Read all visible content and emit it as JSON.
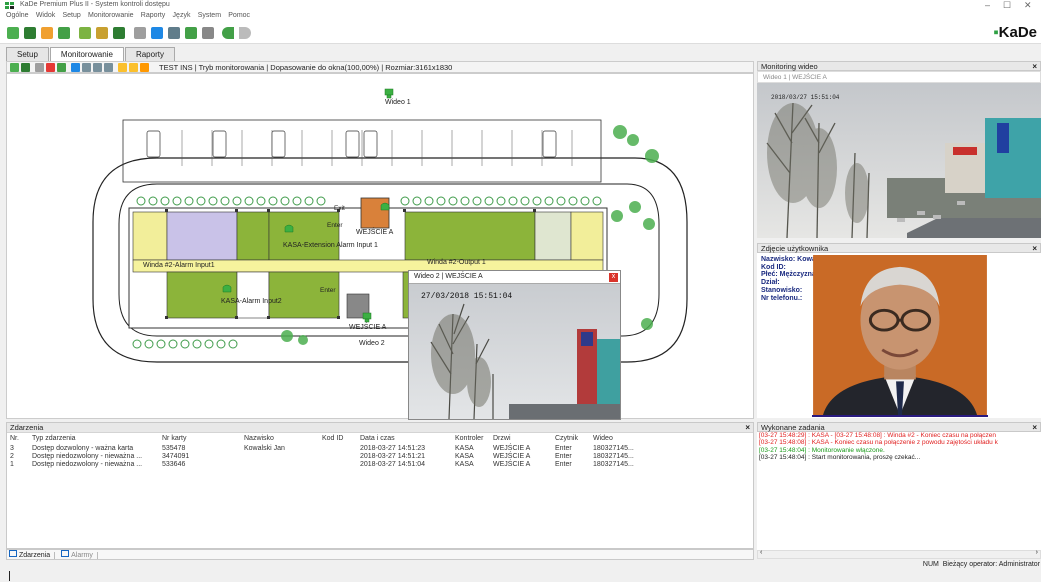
{
  "window": {
    "title": "KaDe Premium Plus II - System kontroli dostępu",
    "controls": [
      "–",
      "☐",
      "✕"
    ]
  },
  "menu": [
    "Ogólne",
    "Widok",
    "Setup",
    "Monitorowanie",
    "Raporty",
    "Język",
    "System",
    "Pomoc"
  ],
  "brand": "KaDe",
  "tabs": [
    "Setup",
    "Monitorowanie",
    "Raporty"
  ],
  "active_tab": "Monitorowanie",
  "map_status": "TEST INS | Tryb monitorowania | Dopasowanie do okna(100,00%) | Rozmiar:3161x1830",
  "map_labels": {
    "wideo1": "Wideo 1",
    "wideo2": "Wideo 2",
    "exit": "Exit",
    "enter1": "Enter",
    "enter2": "Enter",
    "wejscie_top": "WEJŚCIE A",
    "wejscie_bottom": "WEJŚCIE A",
    "kasa_ext": "KASA-Extension Alarm Input 1",
    "winda_alarm": "Winda #2-Alarm Input1",
    "winda_output": "Winda #2-Output 1",
    "kasa_alarm": "KASA-Alarm Input2"
  },
  "video_popup": {
    "title": "Wideo 2 | WEJŚCIE A",
    "timestamp": "27/03/2018 15:51:04",
    "close": "x"
  },
  "camera_panel": {
    "title": "Monitoring wideo",
    "subtitle": "Wideo 1 | WEJŚCIE A",
    "overlay_text": "2018/03/27 15:51:04"
  },
  "user_panel": {
    "title": "Zdjęcie użytkownika",
    "fields": [
      "Nazwisko: Kowalski Jan",
      "Kod ID:",
      "Płeć: Mężczyzna",
      "Dział:",
      "Stanowisko:",
      "Nr telefonu.:"
    ]
  },
  "events": {
    "title": "Zdarzenia",
    "columns": [
      "Nr.",
      "Typ zdarzenia",
      "Nr karty",
      "Nazwisko",
      "Kod ID",
      "Data i czas",
      "Kontroler",
      "Drzwi",
      "Czytnik",
      "Wideo"
    ],
    "rows": [
      [
        "3",
        "Dostęp dozwolony - ważna karta",
        "535478",
        "Kowalski Jan",
        "",
        "2018-03-27 14:51:23",
        "KASA",
        "WEJŚCIE A",
        "Enter",
        "180327145..."
      ],
      [
        "2",
        "Dostęp niedozwolony - nieważna ...",
        "3474091",
        "",
        "",
        "2018-03-27 14:51:21",
        "KASA",
        "WEJŚCIE A",
        "Enter",
        "180327145..."
      ],
      [
        "1",
        "Dostęp niedozwolony - nieważna ...",
        "533646",
        "",
        "",
        "2018-03-27 14:51:04",
        "KASA",
        "WEJŚCIE A",
        "Enter",
        "180327145..."
      ]
    ]
  },
  "bottom_tabs": [
    "Zdarzenia",
    "Alarmy"
  ],
  "tasks": {
    "title": "Wykonane zadania",
    "lines": [
      {
        "text": "[03-27 15:48:29] : KASA - [03-27 15:48:08] : Winda #2 - Koniec czasu na połączen",
        "color": "#e02020"
      },
      {
        "text": "[03-27 15:48:08] : KASA - Koniec czasu na połączenie z powodu zajętości układu k",
        "color": "#e02020"
      },
      {
        "text": "[03-27 15:48:04] : Monitorowanie włączone.",
        "color": "#1a9a1a"
      },
      {
        "text": "[03-27 15:48:04] : Start monitorowania, proszę czekać...",
        "color": "#222222"
      }
    ]
  },
  "status": {
    "num": "NUM",
    "operator": "Bieżący operator: Administrator"
  },
  "colors": {
    "room_green": "#8cb43a",
    "room_yellow": "#f2ee9a",
    "corridor": "#f6f39d",
    "accent_blue": "#1a2a80"
  }
}
